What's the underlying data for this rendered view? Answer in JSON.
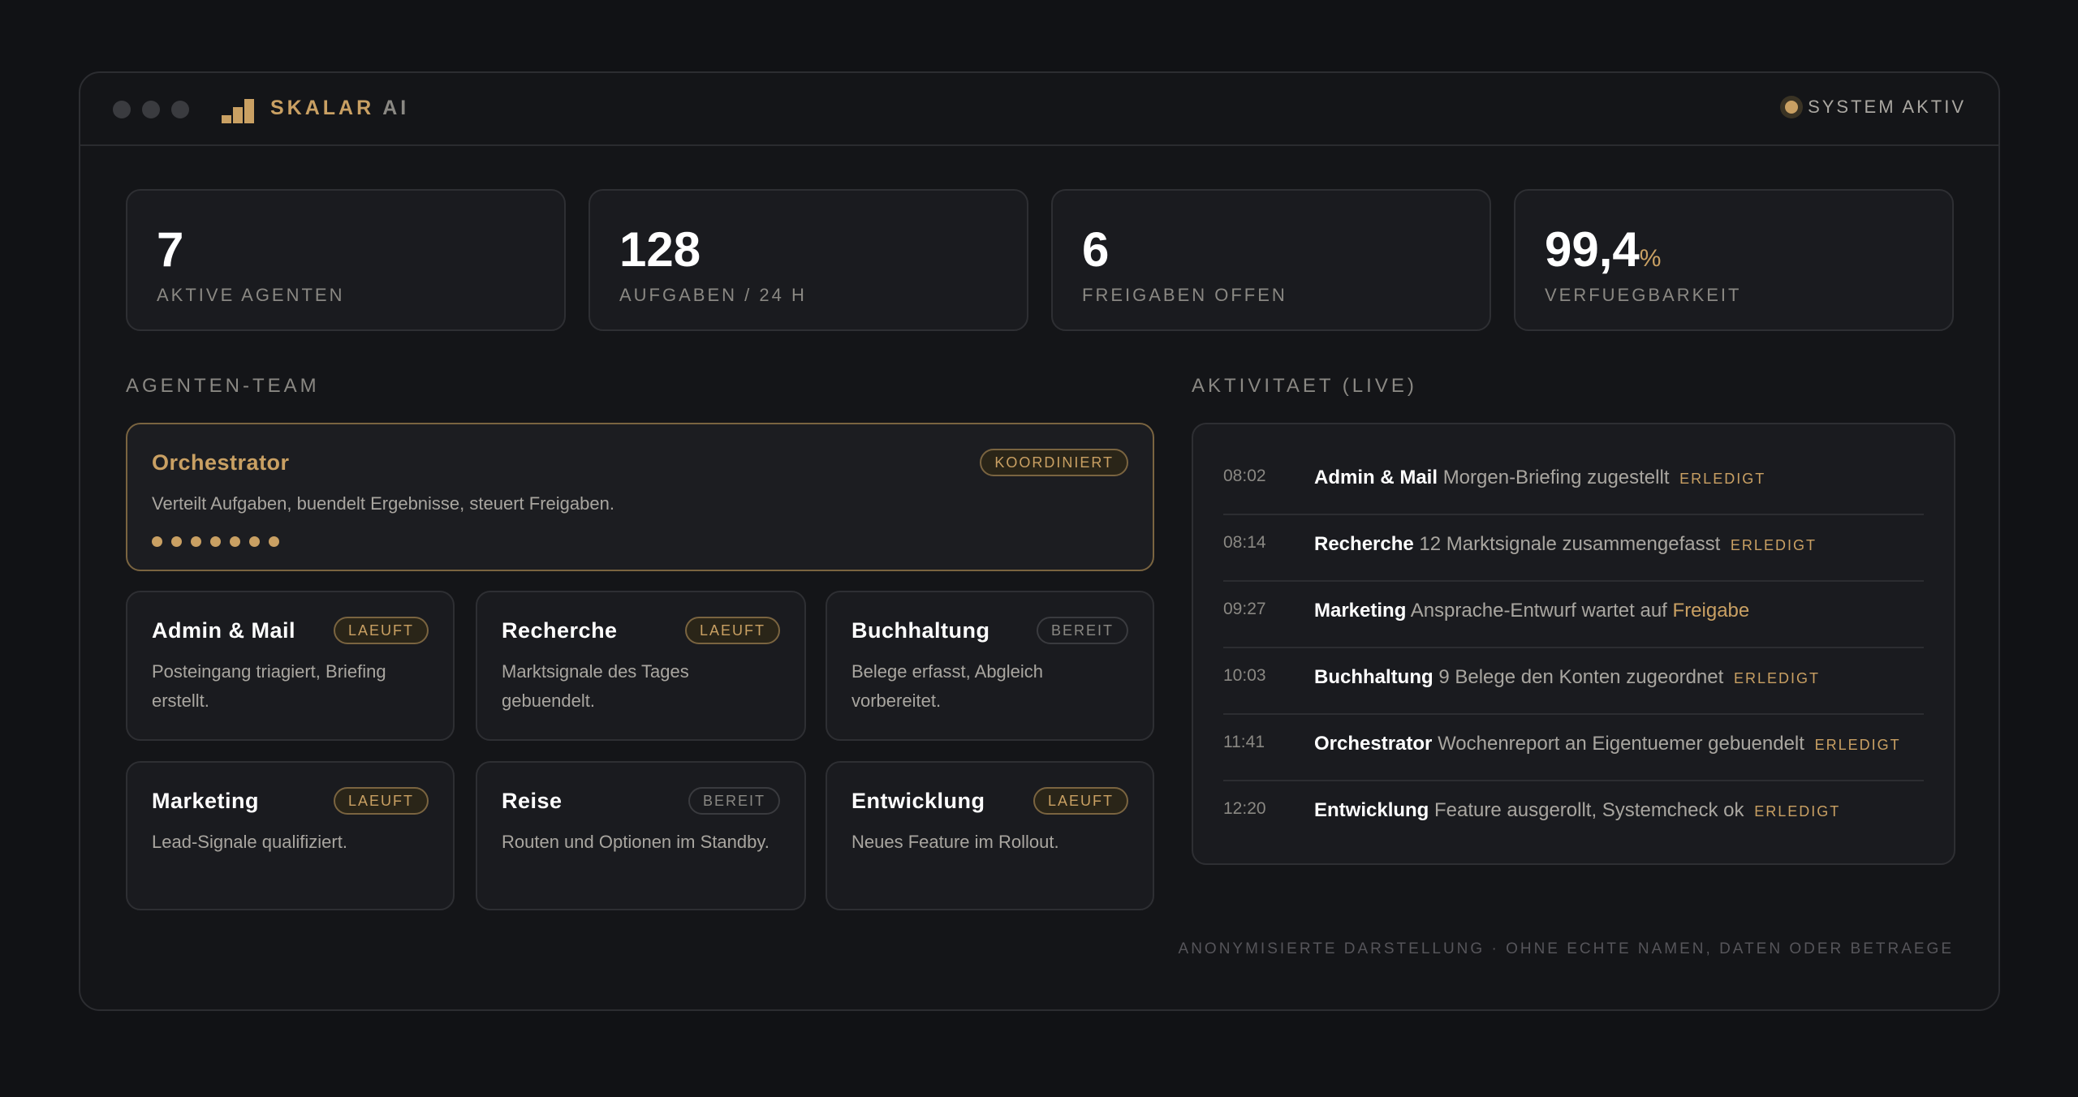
{
  "app": {
    "brand_primary": "SKALAR",
    "brand_secondary": "AI",
    "status_text": "SYSTEM AKTIV"
  },
  "stats": [
    {
      "value": "7",
      "unit": "",
      "label": "AKTIVE AGENTEN"
    },
    {
      "value": "128",
      "unit": "",
      "label": "AUFGABEN / 24 H"
    },
    {
      "value": "6",
      "unit": "",
      "label": "FREIGABEN OFFEN"
    },
    {
      "value": "99,4",
      "unit": "%",
      "label": "VERFUEGBARKEIT"
    }
  ],
  "team": {
    "title": "AGENTEN-TEAM",
    "lead": {
      "name": "Orchestrator",
      "badge": "KOORDINIERT",
      "description": "Verteilt Aufgaben, buendelt Ergebnisse, steuert Freigaben.",
      "connected_agents": 7
    },
    "agents": [
      {
        "name": "Admin & Mail",
        "badge": "LAEUFT",
        "state": "running",
        "description": "Posteingang triagiert, Briefing erstellt."
      },
      {
        "name": "Recherche",
        "badge": "LAEUFT",
        "state": "running",
        "description": "Marktsignale des Tages gebuendelt."
      },
      {
        "name": "Buchhaltung",
        "badge": "BEREIT",
        "state": "idle",
        "description": "Belege erfasst, Abgleich vorbereitet."
      },
      {
        "name": "Marketing",
        "badge": "LAEUFT",
        "state": "running",
        "description": "Lead-Signale qualifiziert."
      },
      {
        "name": "Reise",
        "badge": "BEREIT",
        "state": "idle",
        "description": "Routen und Optionen im Standby."
      },
      {
        "name": "Entwicklung",
        "badge": "LAEUFT",
        "state": "running",
        "description": "Neues Feature im Rollout."
      }
    ]
  },
  "activity": {
    "title": "AKTIVITAET (LIVE)",
    "items": [
      {
        "time": "08:02",
        "agent": "Admin & Mail",
        "text": "Morgen-Briefing zugestellt",
        "tag": "ERLEDIGT",
        "link": ""
      },
      {
        "time": "08:14",
        "agent": "Recherche",
        "text": "12 Marktsignale zusammengefasst",
        "tag": "ERLEDIGT",
        "link": ""
      },
      {
        "time": "09:27",
        "agent": "Marketing",
        "text": "Ansprache-Entwurf wartet auf",
        "tag": "",
        "link": "Freigabe"
      },
      {
        "time": "10:03",
        "agent": "Buchhaltung",
        "text": "9 Belege den Konten zugeordnet",
        "tag": "ERLEDIGT",
        "link": ""
      },
      {
        "time": "11:41",
        "agent": "Orchestrator",
        "text": "Wochenreport an Eigentuemer gebuendelt",
        "tag": "ERLEDIGT",
        "link": ""
      },
      {
        "time": "12:20",
        "agent": "Entwicklung",
        "text": "Feature ausgerollt, Systemcheck ok",
        "tag": "ERLEDIGT",
        "link": ""
      }
    ]
  },
  "footer": "ANONYMISIERTE DARSTELLUNG · OHNE ECHTE NAMEN, DATEN ODER BETRAEGE",
  "colors": {
    "accent": "#c9a063",
    "background": "#111215",
    "card": "#1a1b1f"
  }
}
